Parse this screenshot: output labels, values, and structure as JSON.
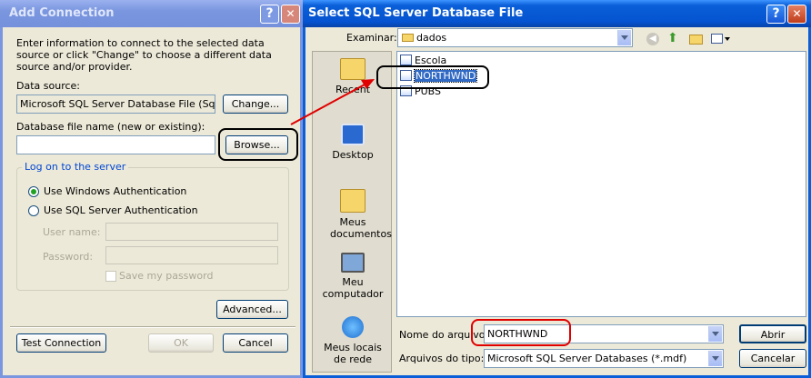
{
  "add_connection": {
    "title": "Add Connection",
    "help_btn": "?",
    "close_btn": "✕",
    "intro": "Enter information to connect to the selected data source or click \"Change\" to choose a different data source and/or provider.",
    "data_source_label": "Data source:",
    "data_source_value": "Microsoft SQL Server Database File (SqlClient)",
    "change_btn": "Change...",
    "db_file_label": "Database file name (new or existing):",
    "db_file_value": "",
    "browse_btn": "Browse...",
    "logon_group": "Log on to the server",
    "windows_auth": "Use Windows Authentication",
    "sql_auth": "Use SQL Server Authentication",
    "user_name_label": "User name:",
    "password_label": "Password:",
    "save_password": "Save my password",
    "advanced_btn": "Advanced...",
    "test_btn": "Test Connection",
    "ok_btn": "OK",
    "cancel_btn": "Cancel"
  },
  "file_dialog": {
    "title": "Select SQL Server Database File",
    "help_btn": "?",
    "close_btn": "✕",
    "look_in_label": "Examinar:",
    "look_in_value": "dados",
    "places": [
      "Recent",
      "Desktop",
      "Meus documentos",
      "Meu computador",
      "Meus locais de rede"
    ],
    "files": [
      "Escola",
      "NORTHWND",
      "PUBS"
    ],
    "file_name_label": "Nome do arquivo:",
    "file_name_value": "NORTHWND",
    "file_type_label": "Arquivos do tipo:",
    "file_type_value": "Microsoft SQL Server Databases (*.mdf)",
    "open_btn": "Abrir",
    "cancel_btn": "Cancelar"
  },
  "colors": {
    "title_active": "#0a5fd8",
    "title_inactive": "#7a96df",
    "selection": "#316ac5",
    "annotation_red": "#e00000"
  }
}
